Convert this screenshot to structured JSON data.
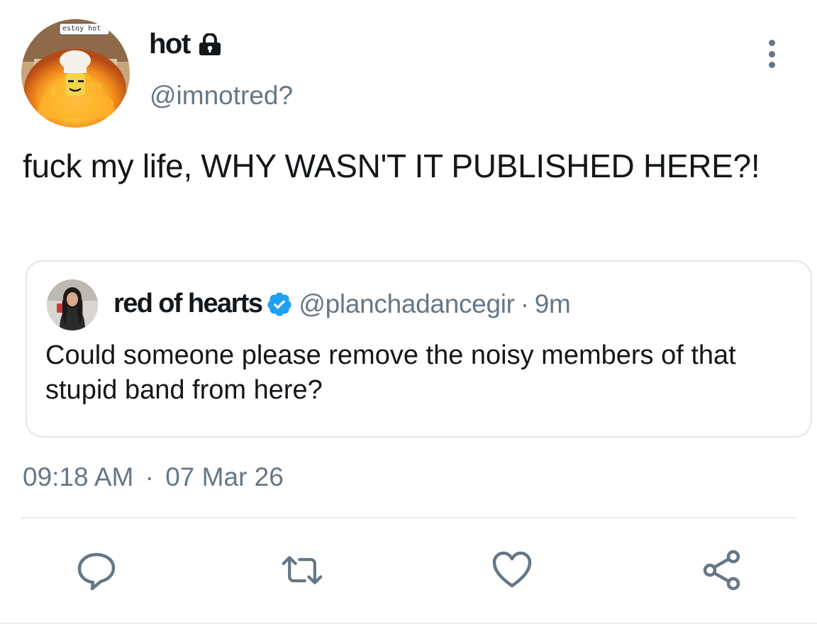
{
  "author": {
    "display_name": "hot",
    "handle": "@imnotred?",
    "avatar_sign_text": "estoy hot",
    "protected_icon": "lock-icon"
  },
  "tweet": {
    "text": "fuck my life, WHY WASN'T IT PUBLISHED HERE?!"
  },
  "quoted": {
    "display_name": "red of hearts",
    "verified_icon": "verified-badge-icon",
    "handle": "@planchadancegir",
    "separator": "·",
    "time": "9m",
    "text": "Could someone please remove the noisy members of that stupid band from here?"
  },
  "timestamp": {
    "time": "09:18 AM",
    "separator": "·",
    "date": "07 Mar 26"
  },
  "actions": [
    "reply-icon",
    "retweet-icon",
    "like-icon",
    "share-icon"
  ],
  "colors": {
    "text": "#14171a",
    "secondary": "#657786",
    "border": "#e1e8ed",
    "verified": "#1da1f2"
  }
}
